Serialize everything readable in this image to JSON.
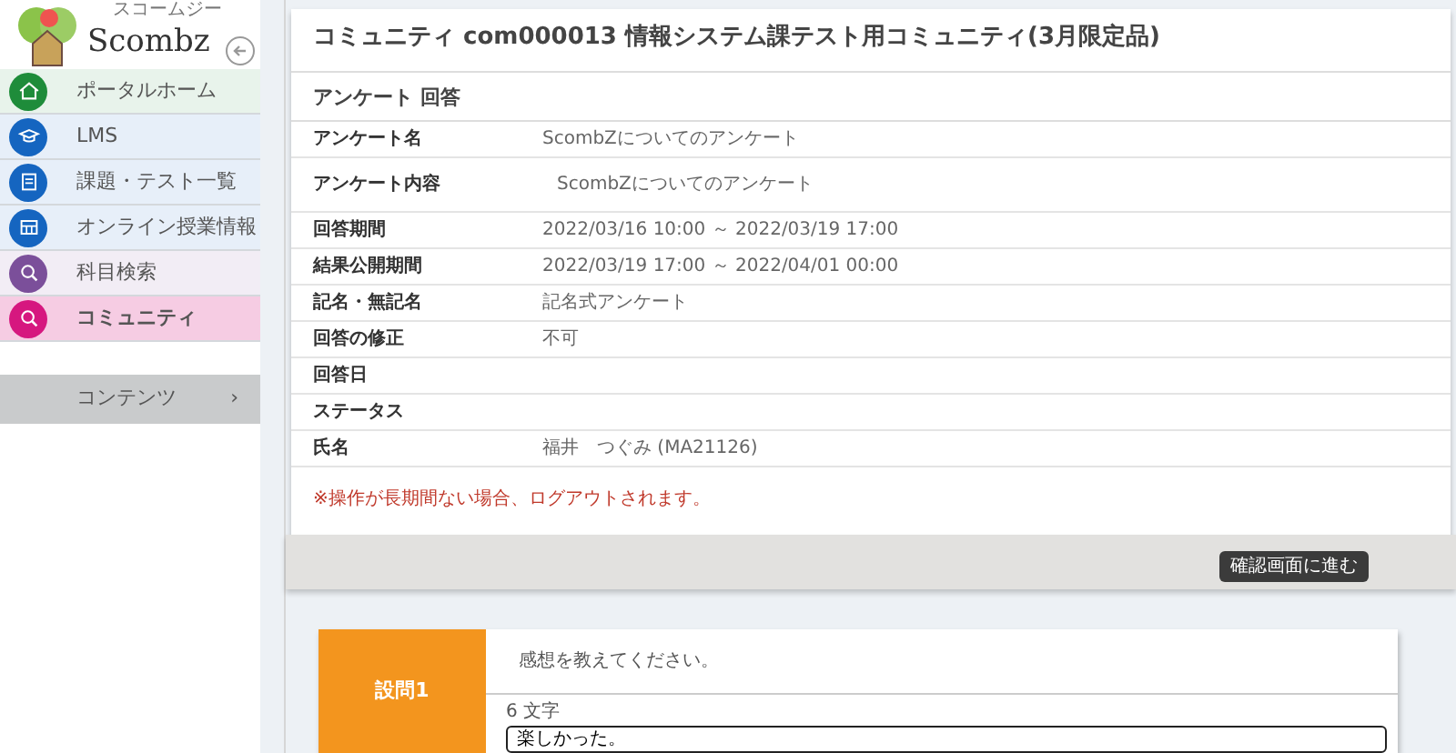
{
  "logo": {
    "text": "Scombz",
    "subtitle": "スコームジー"
  },
  "sidebar": {
    "items": [
      {
        "label": "ポータルホーム",
        "color": "#1e8c3a",
        "selected": false
      },
      {
        "label": "LMS",
        "color": "#1565c0",
        "selected": false
      },
      {
        "label": "課題・テスト一覧",
        "color": "#1565c0",
        "selected": false
      },
      {
        "label": "オンライン授業情報",
        "color": "#1565c0",
        "selected": false
      },
      {
        "label": "科目検索",
        "color": "#7b4f9a",
        "selected": false
      },
      {
        "label": "コミュニティ",
        "color": "#d6177f",
        "selected": true
      }
    ],
    "contents": {
      "label": "コンテンツ",
      "chevron": "›"
    }
  },
  "page_title": "コミュニティ com000013 情報システム課テスト用コミュニティ(3月限定品)",
  "section_title": "アンケート 回答",
  "details": [
    {
      "label": "アンケート名",
      "value": "ScombZについてのアンケート"
    },
    {
      "label": "アンケート内容",
      "value": "ScombZについてのアンケート"
    },
    {
      "label": "回答期間",
      "value": "2022/03/16 10:00 ～ 2022/03/19 17:00"
    },
    {
      "label": "結果公開期間",
      "value": "2022/03/19 17:00 ～ 2022/04/01 00:00"
    },
    {
      "label": "記名・無記名",
      "value": "記名式アンケート"
    },
    {
      "label": "回答の修正",
      "value": "不可"
    },
    {
      "label": "回答日"
    },
    {
      "label": "ステータス"
    },
    {
      "label": "氏名",
      "value": "福井　つぐみ (MA21126)"
    }
  ],
  "notice": "※操作が長期間ない場合、ログアウトされます。",
  "confirm_button": "確認画面に進む",
  "questions": [
    {
      "number": "設問1",
      "text": "感想を教えてください。",
      "char_count": "6 文字",
      "answer": "楽しかった。"
    }
  ]
}
